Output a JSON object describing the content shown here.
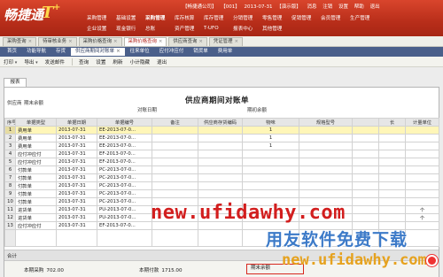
{
  "app": {
    "logo": "畅捷通",
    "logo_t": "T",
    "logo_plus": "+",
    "status": [
      "【畅捷通公司】",
      "【001】",
      "2013-07-31",
      "【演示版】"
    ],
    "status_right": [
      "消息",
      "注销",
      "设置",
      "帮助",
      "退出"
    ]
  },
  "modules_row1": [
    "采购管理",
    "基础设置",
    "采购管理",
    "库存核算",
    "库存管理",
    "分销管理",
    "零售管理",
    "促销管理",
    "会员管理",
    "生产管理"
  ],
  "modules_row2": [
    "企业设置",
    "现金银行",
    "总账",
    "资产管理",
    "T-UFO",
    "报表中心",
    "其他管理",
    "",
    "",
    ""
  ],
  "page_tabs": [
    "采购查询",
    "待审核业务",
    "采购价格查询",
    "采购价格查询",
    "供应商查询",
    "凭证管理"
  ],
  "sub_tabs": [
    "首页",
    "功能导航",
    "存货",
    "供应商期间对账单",
    "往来单位",
    "应付冲应付",
    "销货单",
    "费用单"
  ],
  "toolbar": [
    "打印",
    "导出",
    "发送邮件",
    "查询",
    "设置",
    "刷新",
    "小计隐藏",
    "退出"
  ],
  "report": {
    "tab": "报表",
    "title": "供应商期间对账单",
    "period_label": "期末余额",
    "supplier_label": "供应商",
    "date_label": "对账日期",
    "balance_label": "期初余额",
    "columns": [
      "序号",
      "单据类型",
      "单据日期",
      "单据编号",
      "备注",
      "供应商存货编码",
      "物味",
      "规格型号",
      "",
      "长",
      "计量单位"
    ],
    "rows": [
      [
        "1",
        "费用单",
        "2013-07-31",
        "EE-2013-07-0...",
        "",
        "",
        "1",
        "",
        "",
        "",
        ""
      ],
      [
        "2",
        "费用单",
        "2013-07-31",
        "EE-2013-07-0...",
        "",
        "",
        "1",
        "",
        "",
        "",
        ""
      ],
      [
        "3",
        "费用单",
        "2013-07-31",
        "EE-2013-07-0...",
        "",
        "",
        "1",
        "",
        "",
        "",
        ""
      ],
      [
        "4",
        "应付冲应付",
        "2013-07-31",
        "EF-2013-07-0...",
        "",
        "",
        "",
        "",
        "",
        "",
        ""
      ],
      [
        "5",
        "应付冲应付",
        "2013-07-31",
        "EF-2013-07-0...",
        "",
        "",
        "",
        "",
        "",
        "",
        ""
      ],
      [
        "6",
        "付款单",
        "2013-07-31",
        "PC-2013-07-0...",
        "",
        "",
        "",
        "",
        "",
        "",
        ""
      ],
      [
        "7",
        "付款单",
        "2013-07-31",
        "PC-2013-07-0...",
        "",
        "",
        "",
        "",
        "",
        "",
        ""
      ],
      [
        "8",
        "付款单",
        "2013-07-31",
        "PC-2013-07-0...",
        "",
        "",
        "",
        "",
        "",
        "",
        ""
      ],
      [
        "9",
        "付款单",
        "2013-07-31",
        "PC-2013-07-0...",
        "",
        "",
        "",
        "",
        "",
        "",
        ""
      ],
      [
        "10",
        "付款单",
        "2013-07-31",
        "PC-2013-07-0...",
        "",
        "",
        "",
        "",
        "",
        "",
        ""
      ],
      [
        "11",
        "进货单",
        "2013-07-31",
        "PU-2013-07-0...",
        "",
        "",
        "",
        "",
        "",
        "",
        "个"
      ],
      [
        "12",
        "进货单",
        "2013-07-31",
        "PU-2013-07-0...",
        "",
        "",
        "",
        "",
        "",
        "",
        "个"
      ],
      [
        "13",
        "应付冲应付",
        "2013-07-31",
        "EF-2013-07-0...",
        "",
        "",
        "",
        "",
        "",
        "",
        ""
      ]
    ],
    "total_label": "合计",
    "purchase_label": "本期采购",
    "purchase_value": "702.00",
    "payment_label": "本期付款",
    "payment_value": "1715.00",
    "end_balance_label": "期末余额"
  },
  "watermarks": {
    "url": "new.ufidawhy.com",
    "slogan": "用友软件免费下载",
    "url2": "new.ufidawhy.com"
  }
}
